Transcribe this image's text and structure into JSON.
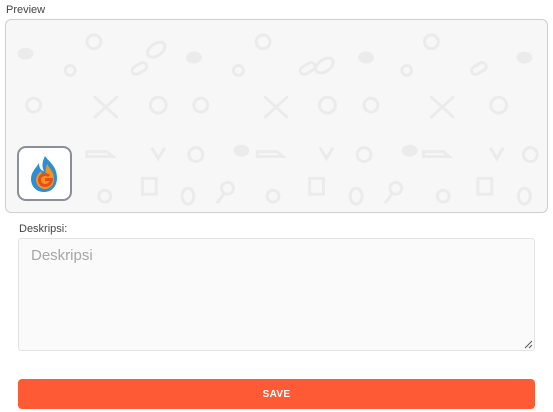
{
  "preview": {
    "label": "Preview",
    "background_pattern_icon": "sports-doodle-pattern",
    "logo_icon": "flame-g-logo-icon"
  },
  "description": {
    "label": "Deskripsi:",
    "placeholder": "Deskripsi",
    "value": ""
  },
  "save_button": {
    "label": "SAVE",
    "color": "#ff5a36"
  }
}
